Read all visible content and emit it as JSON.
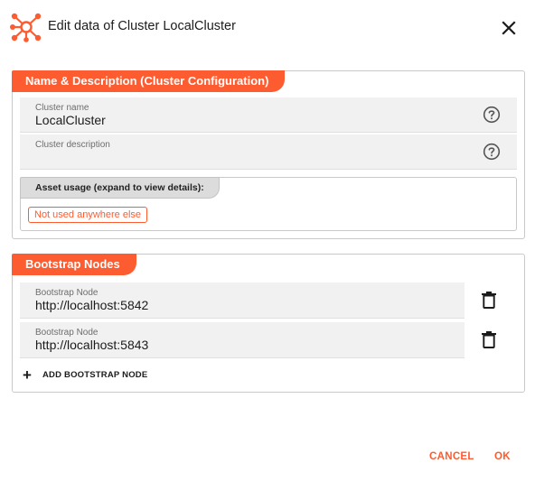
{
  "dialog": {
    "title": "Edit data of Cluster LocalCluster",
    "logo_icon": "cluster-network-icon",
    "close_icon": "close-icon"
  },
  "name_section": {
    "header": "Name & Description (Cluster Configuration)",
    "cluster_name": {
      "label": "Cluster name",
      "value": "LocalCluster"
    },
    "cluster_description": {
      "label": "Cluster description",
      "value": ""
    },
    "asset_usage": {
      "header": "Asset usage (expand to view details):",
      "chip": "Not used anywhere else"
    }
  },
  "bootstrap_section": {
    "header": "Bootstrap Nodes",
    "nodes": [
      {
        "label": "Bootstrap Node",
        "value": "http://localhost:5842"
      },
      {
        "label": "Bootstrap Node",
        "value": "http://localhost:5843"
      }
    ],
    "add_label": "ADD BOOTSTRAP NODE"
  },
  "footer": {
    "cancel": "CANCEL",
    "ok": "OK"
  },
  "colors": {
    "accent": "#fd5b30",
    "field_bg": "#f1f1f1",
    "border": "#c9c9c9"
  }
}
